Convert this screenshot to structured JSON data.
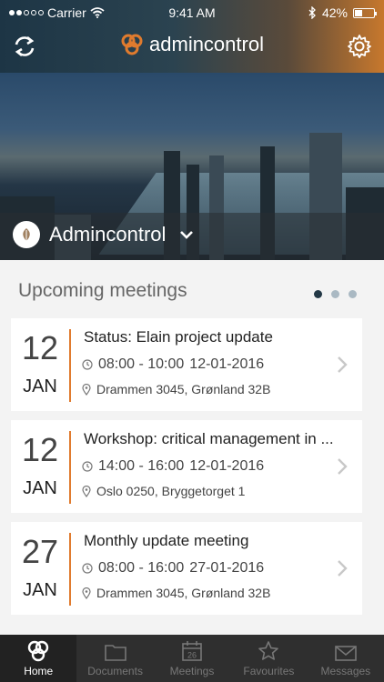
{
  "status_bar": {
    "carrier": "Carrier",
    "time": "9:41 AM",
    "battery": "42%",
    "battery_level": 0.42,
    "signal_dots_filled": 2,
    "signal_dots_total": 5
  },
  "header": {
    "brand": "admincontrol",
    "accent_color": "#e07b2e",
    "refresh_icon": "refresh-icon",
    "settings_icon": "gear-icon"
  },
  "organization": {
    "name": "Admincontrol"
  },
  "meetings": {
    "section_title": "Upcoming meetings",
    "pager": {
      "pages": 3,
      "active": 0
    },
    "items": [
      {
        "day": "12",
        "month": "JAN",
        "title": "Status: Elain project update",
        "time": "08:00 - 10:00",
        "date": "12-01-2016",
        "location": "Drammen 3045, Grønland 32B"
      },
      {
        "day": "12",
        "month": "JAN",
        "title": "Workshop: critical management in ...",
        "time": "14:00 - 16:00",
        "date": "12-01-2016",
        "location": "Oslo 0250, Bryggetorget 1"
      },
      {
        "day": "27",
        "month": "JAN",
        "title": "Monthly update meeting",
        "time": "08:00 - 16:00",
        "date": "27-01-2016",
        "location": "Drammen 3045, Grønland 32B"
      }
    ]
  },
  "tabbar": {
    "tabs": [
      {
        "label": "Home",
        "icon": "home-logo-icon",
        "active": true
      },
      {
        "label": "Documents",
        "icon": "folder-icon",
        "active": false
      },
      {
        "label": "Meetings",
        "icon": "calendar-icon",
        "active": false
      },
      {
        "label": "Favourites",
        "icon": "star-icon",
        "active": false
      },
      {
        "label": "Messages",
        "icon": "envelope-icon",
        "active": false
      }
    ],
    "calendar_icon_day": "26"
  }
}
